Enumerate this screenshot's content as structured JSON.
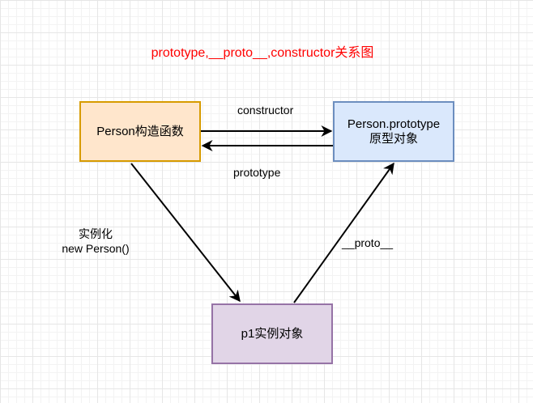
{
  "title": "prototype,__proto__,constructor关系图",
  "nodes": {
    "person": {
      "label": "Person构造函数",
      "fill": "#ffe6cc",
      "stroke": "#d79b00"
    },
    "prototype": {
      "line1": "Person.prototype",
      "line2": "原型对象",
      "fill": "#dae8fc",
      "stroke": "#6c8ebf"
    },
    "p1": {
      "label": "p1实例对象",
      "fill": "#e1d5e7",
      "stroke": "#9673a6"
    }
  },
  "edges": {
    "constructor_label": "constructor",
    "prototype_label": "prototype",
    "instantiate_line1": "实例化",
    "instantiate_line2": "new Person()",
    "proto_label": "__proto__"
  }
}
